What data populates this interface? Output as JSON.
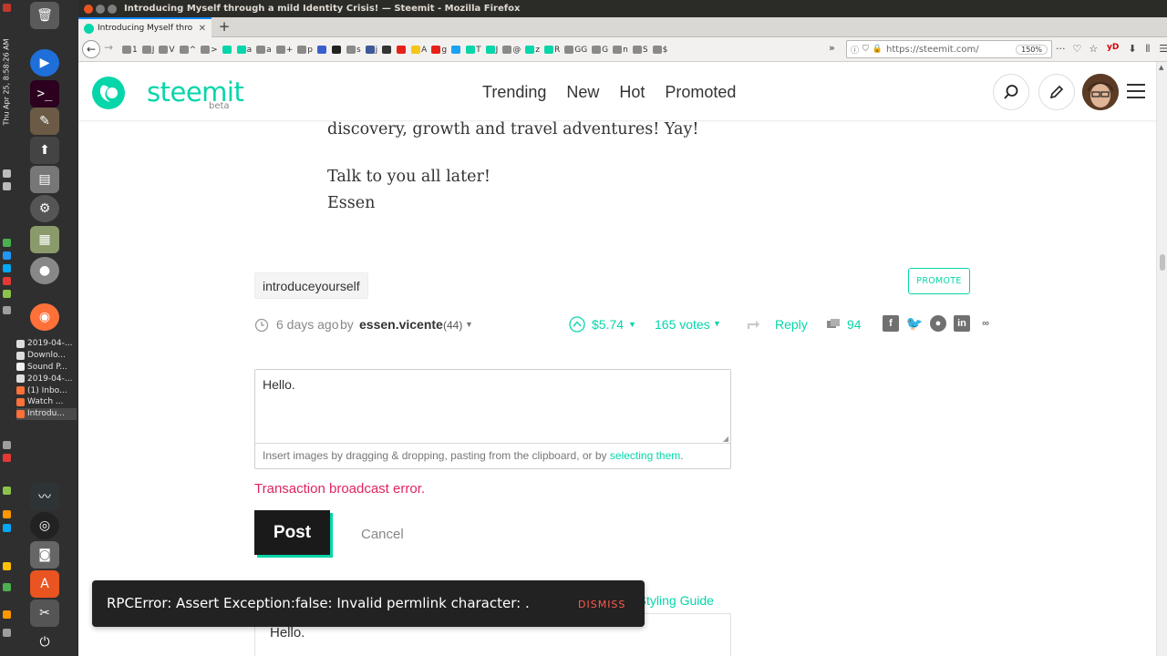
{
  "os": {
    "window_title": "Introducing Myself through a mild Identity Crisis! — Steemit - Mozilla Firefox",
    "datetime": "Thu Apr 25, 8:58:26 AM",
    "dock_tasks": [
      {
        "label": "2019-04-...",
        "color": "#dddddd"
      },
      {
        "label": "Downlo...",
        "color": "#dddddd"
      },
      {
        "label": "Sound P...",
        "color": "#f0f0f0"
      },
      {
        "label": "2019-04-...",
        "color": "#dddddd"
      },
      {
        "label": "(1) Inbo...",
        "color": "#ff7139"
      },
      {
        "label": "Watch ...",
        "color": "#ff7139"
      },
      {
        "label": "Introdu...",
        "color": "#ff7139"
      }
    ]
  },
  "browser": {
    "tab_title": "Introducing Myself thro",
    "url": "https://steemit.com/",
    "zoom": "150%",
    "bookmarks": [
      "1",
      "J",
      "V",
      "^",
      ">",
      "",
      "a",
      "a",
      "+",
      "p",
      "",
      "",
      "s",
      "j",
      "",
      "",
      "A",
      "g",
      "",
      "T",
      "J",
      "@",
      "z",
      "R",
      "GG",
      "G",
      "n",
      "S",
      "$"
    ],
    "bookmark_colors": [
      "#8a8a8a",
      "#8a8a8a",
      "#8a8a8a",
      "#8a8a8a",
      "#8a8a8a",
      "#06d6a9",
      "#06d6a9",
      "#8a8a8a",
      "#8a8a8a",
      "#8a8a8a",
      "#3a5fcd",
      "#222222",
      "#8a8a8a",
      "#3b5998",
      "#333333",
      "#e62117",
      "#f5c518",
      "#e62117",
      "#1da1f2",
      "#06d6a9",
      "#06d6a9",
      "#8a8a8a",
      "#06d6a9",
      "#06d6a9",
      "#8a8a8a",
      "#8a8a8a",
      "#8a8a8a",
      "#8a8a8a",
      "#8a8a8a"
    ]
  },
  "site": {
    "logo": "steemit",
    "beta": "beta",
    "nav": [
      "Trending",
      "New",
      "Hot",
      "Promoted"
    ],
    "brand_color": "#06d6a9"
  },
  "article": {
    "line1": "discovery, growth and travel adventures! Yay!",
    "line2": "Talk to you all later!",
    "line3": "Essen",
    "tag": "introduceyourself",
    "promote": "PROMOTE",
    "time": "6 days ago",
    "by": "by",
    "author": "essen.vicente",
    "reputation": "(44)",
    "payout": "$5.74",
    "votes": "165 votes",
    "reply": "Reply",
    "comments": "94"
  },
  "reply_editor": {
    "text": "Hello.",
    "hint_prefix": "Insert images by dragging & dropping, pasting from the clipboard, or by ",
    "hint_link": "selecting them",
    "hint_suffix": ".",
    "error": "Transaction broadcast error.",
    "post": "Post",
    "cancel": "Cancel",
    "styling_guide": "n Styling Guide",
    "preview": "Hello."
  },
  "toast": {
    "message": "RPCError: Assert Exception:false: Invalid permlink character: .",
    "dismiss": "DISMISS"
  }
}
